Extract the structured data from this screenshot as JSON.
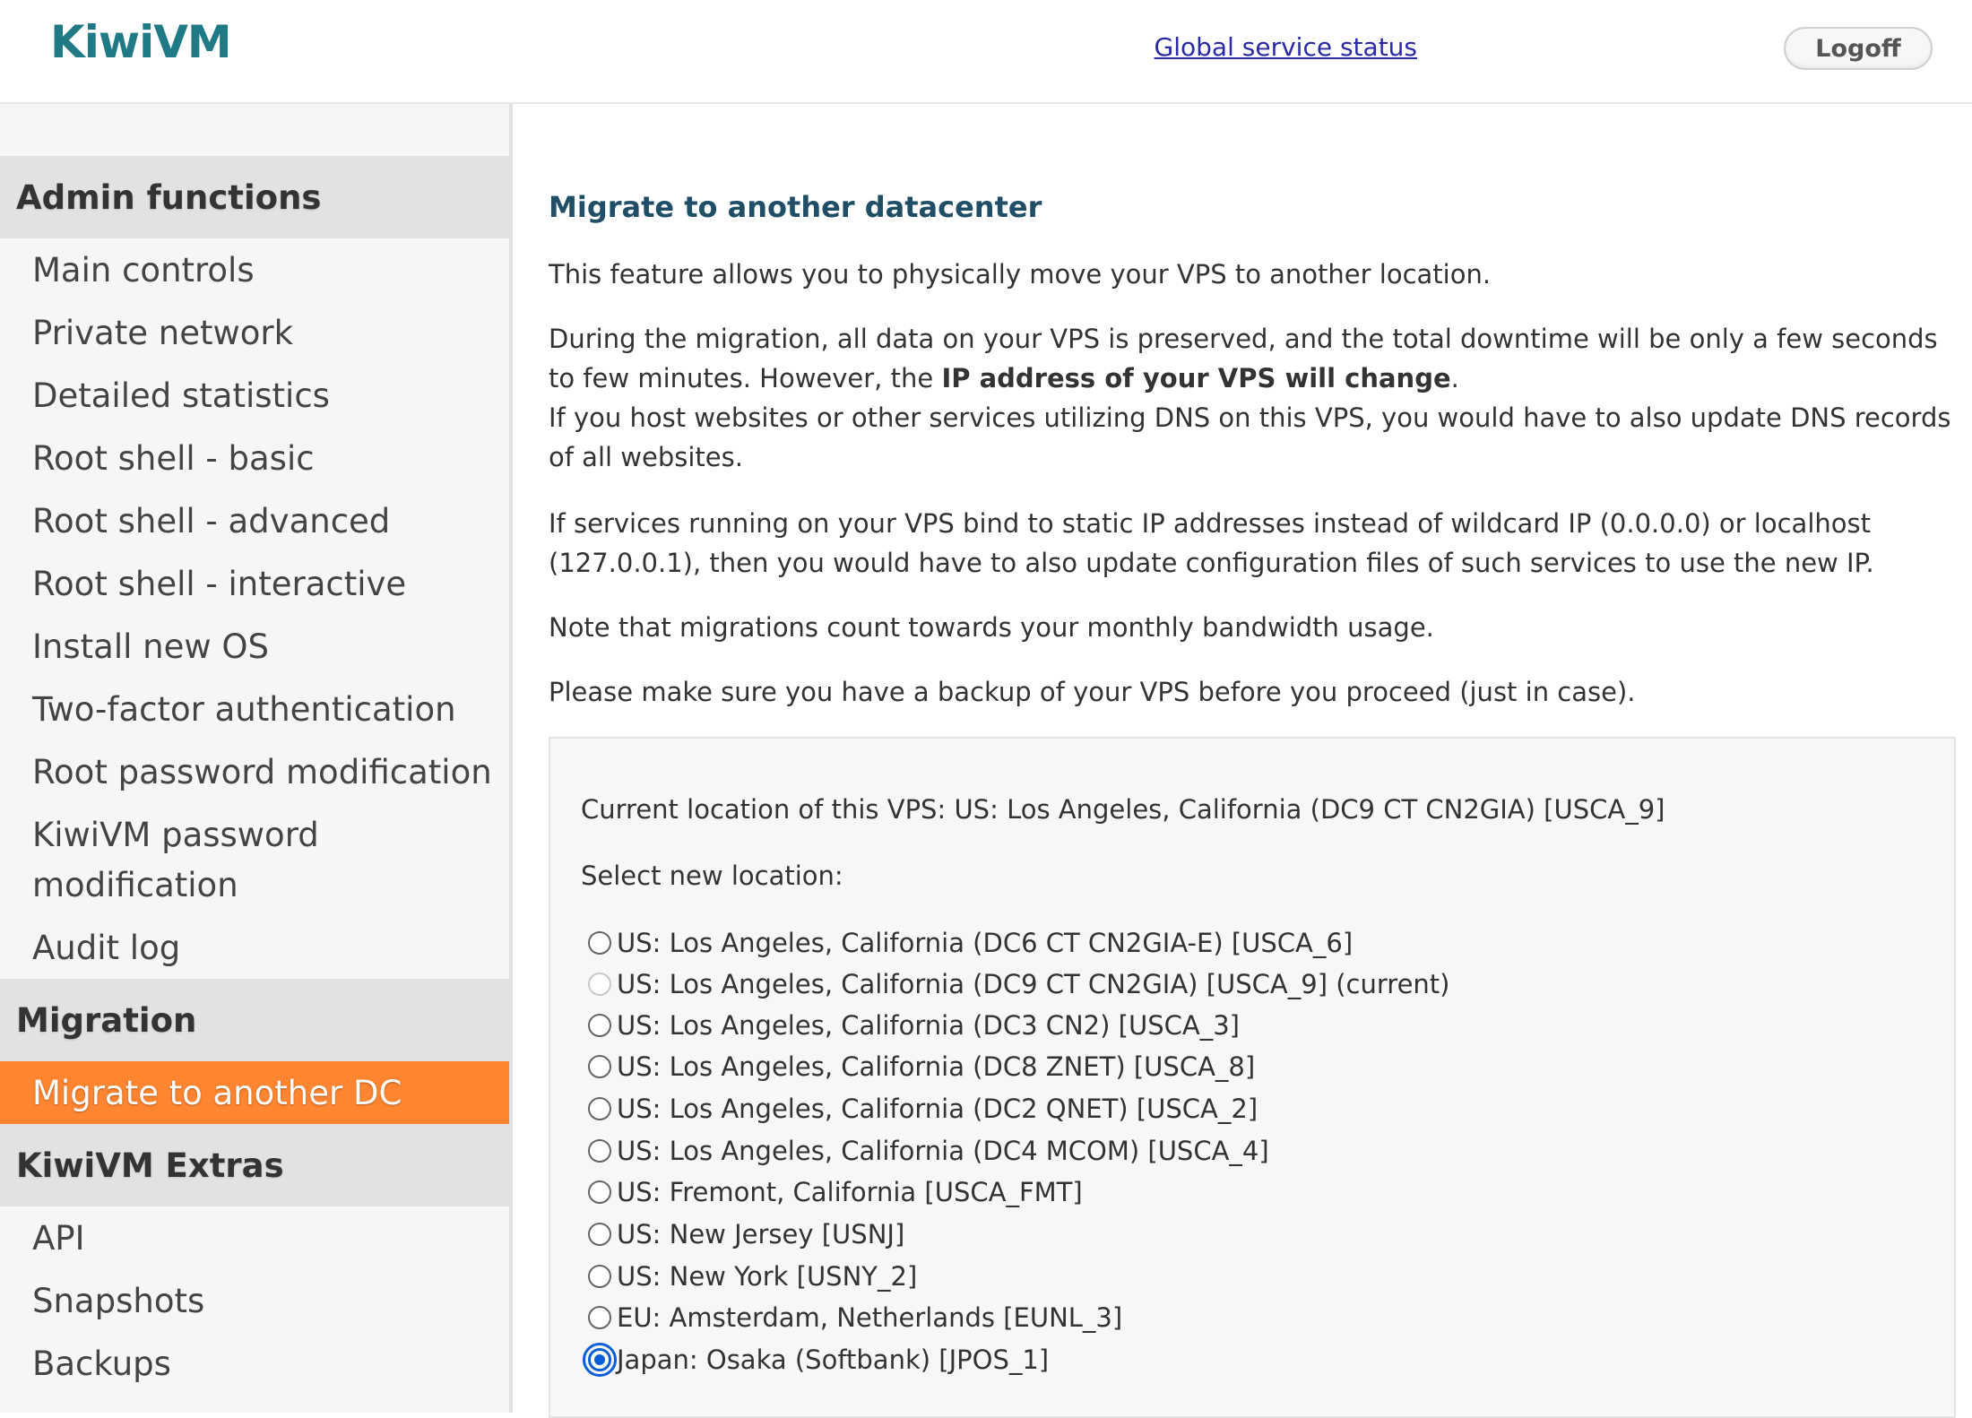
{
  "header": {
    "logo": "KiwiVM",
    "status_link": "Global service status",
    "logoff": "Logoff"
  },
  "sidebar": {
    "sections": [
      {
        "title": "Admin functions",
        "items": [
          "Main controls",
          "Private network",
          "Detailed statistics",
          "Root shell - basic",
          "Root shell - advanced",
          "Root shell - interactive",
          "Install new OS",
          "Two-factor authentication",
          "Root password modification",
          "KiwiVM password modification",
          "Audit log"
        ]
      },
      {
        "title": "Migration",
        "items": [
          "Migrate to another DC"
        ]
      },
      {
        "title": "KiwiVM Extras",
        "items": [
          "API",
          "Snapshots",
          "Backups"
        ]
      }
    ],
    "active_item": "Migrate to another DC"
  },
  "main": {
    "title": "Migrate to another datacenter",
    "p1": "This feature allows you to physically move your VPS to another location.",
    "p2a": "During the migration, all data on your VPS is preserved, and the total downtime will be only a few seconds to few minutes. However, the ",
    "p2b": "IP address of your VPS will change",
    "p2c": ".",
    "p2d": "If you host websites or other services utilizing DNS on this VPS, you would have to also update DNS records of all websites.",
    "p3": "If services running on your VPS bind to static IP addresses instead of wildcard IP (0.0.0.0) or localhost (127.0.0.1), then you would have to also update configuration files of such services to use the new IP.",
    "p4": "Note that migrations count towards your monthly bandwidth usage.",
    "p5": "Please make sure you have a backup of your VPS before you proceed (just in case).",
    "current_location": "Current location of this VPS: US: Los Angeles, California (DC9 CT CN2GIA) [USCA_9]",
    "select_label": "Select new location:",
    "options": [
      {
        "label": "US: Los Angeles, California (DC6 CT CN2GIA-E) [USCA_6]",
        "state": "normal"
      },
      {
        "label": "US: Los Angeles, California (DC9 CT CN2GIA) [USCA_9] (current)",
        "state": "disabled"
      },
      {
        "label": "US: Los Angeles, California (DC3 CN2) [USCA_3]",
        "state": "normal"
      },
      {
        "label": "US: Los Angeles, California (DC8 ZNET) [USCA_8]",
        "state": "normal"
      },
      {
        "label": "US: Los Angeles, California (DC2 QNET) [USCA_2]",
        "state": "normal"
      },
      {
        "label": "US: Los Angeles, California (DC4 MCOM) [USCA_4]",
        "state": "normal"
      },
      {
        "label": "US: Fremont, California [USCA_FMT]",
        "state": "normal"
      },
      {
        "label": "US: New Jersey [USNJ]",
        "state": "normal"
      },
      {
        "label": "US: New York [USNY_2]",
        "state": "normal"
      },
      {
        "label": "EU: Amsterdam, Netherlands [EUNL_3]",
        "state": "normal"
      },
      {
        "label": "Japan: Osaka (Softbank) [JPOS_1]",
        "state": "checked"
      }
    ]
  },
  "colors": {
    "accent": "#ff8530",
    "logo": "#1f7a86",
    "title": "#1f4e66",
    "link": "#2a2aa6"
  }
}
